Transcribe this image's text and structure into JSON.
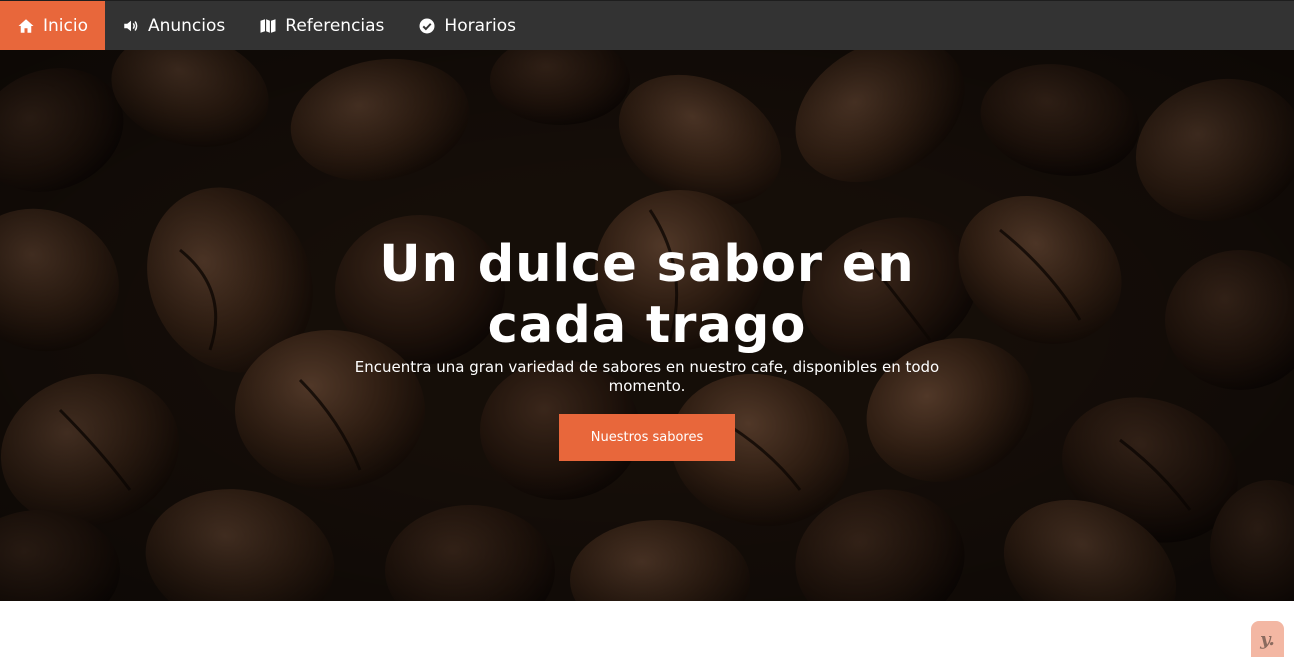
{
  "nav": {
    "items": [
      {
        "label": "Inicio",
        "icon": "home-icon",
        "active": true
      },
      {
        "label": "Anuncios",
        "icon": "speaker-icon",
        "active": false
      },
      {
        "label": "Referencias",
        "icon": "map-icon",
        "active": false
      },
      {
        "label": "Horarios",
        "icon": "check-circle-icon",
        "active": false
      }
    ]
  },
  "hero": {
    "title": "Un dulce sabor en cada trago",
    "subtitle": "Encuentra una gran variedad de sabores en nuestro cafe, disponibles en todo momento.",
    "button_label": "Nuestros sabores",
    "background": "coffee-beans-photo"
  },
  "badge": {
    "text": "y."
  },
  "colors": {
    "accent": "#e8673b",
    "navbar": "#333333",
    "text": "#ffffff"
  }
}
